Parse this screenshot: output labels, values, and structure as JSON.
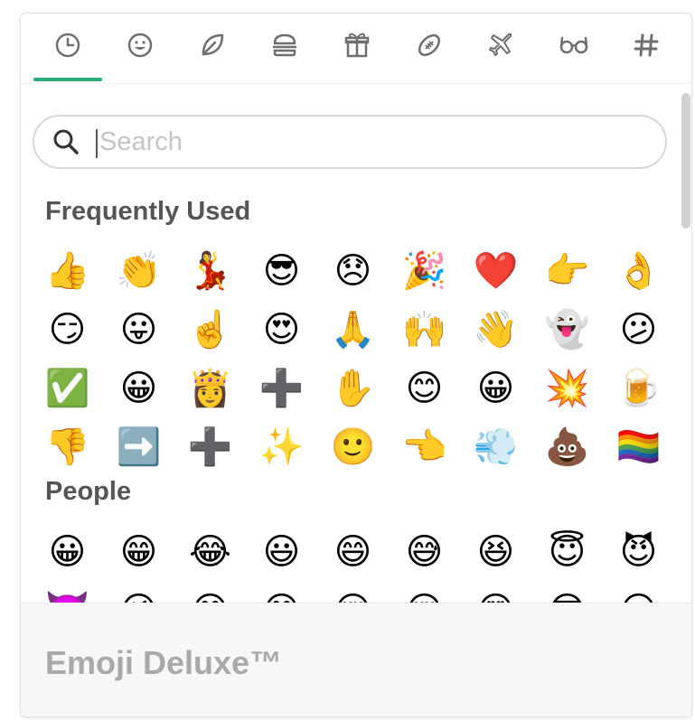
{
  "tabs": [
    {
      "name": "frequently-used",
      "icon": "clock-icon",
      "active": true
    },
    {
      "name": "people",
      "icon": "smiley-icon"
    },
    {
      "name": "nature",
      "icon": "leaf-icon"
    },
    {
      "name": "food",
      "icon": "burger-icon"
    },
    {
      "name": "celebration",
      "icon": "gift-icon"
    },
    {
      "name": "activity",
      "icon": "football-icon"
    },
    {
      "name": "travel",
      "icon": "airplane-icon"
    },
    {
      "name": "objects",
      "icon": "glasses-icon"
    },
    {
      "name": "symbols",
      "icon": "hash-icon"
    }
  ],
  "colors": {
    "accent": "#2bac76",
    "icon": "#6f6f6f",
    "section_title": "#555555",
    "footer_title": "#a9a9a9"
  },
  "search": {
    "placeholder": "Search",
    "value": ""
  },
  "sections": [
    {
      "title": "Frequently Used",
      "emojis": [
        "👍",
        "👏",
        "💃",
        "😎",
        "😞",
        "🎉",
        "❤️",
        "👉",
        "👌",
        "😏",
        "😛",
        "☝️",
        "😍",
        "🙏",
        "🙌",
        "👋",
        "👻",
        "😕",
        "✅",
        "😀",
        "👸",
        "➕",
        "✋",
        "😊",
        "😀",
        "💥",
        "🍺",
        "👎",
        "➡️",
        "➕",
        "✨",
        "🙂",
        "👈",
        "💨",
        "💩",
        "🏳️‍🌈"
      ]
    },
    {
      "title": "People",
      "emojis": [
        "😀",
        "😁",
        "😂",
        "😃",
        "😄",
        "😅",
        "😆",
        "😇",
        "😈",
        "👿",
        "😉",
        "😊",
        "😋",
        "😌",
        "😌",
        "😍",
        "😎",
        "😏"
      ]
    }
  ],
  "footer": {
    "title": "Emoji Deluxe™"
  }
}
